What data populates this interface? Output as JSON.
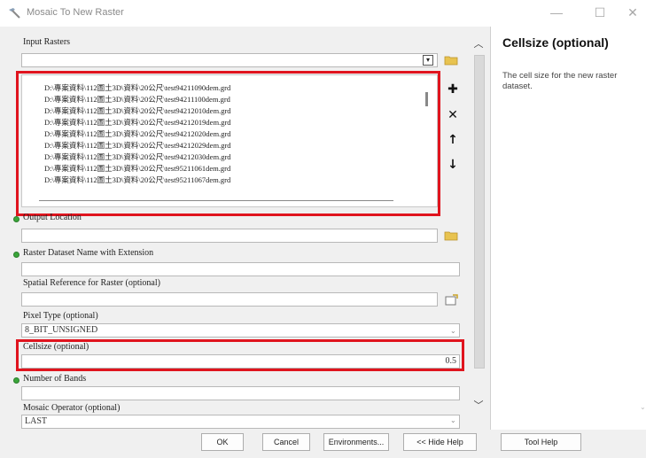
{
  "window": {
    "title": "Mosaic To New Raster",
    "minimize_glyph": "—",
    "maximize_glyph": "☐",
    "close_glyph": "✕"
  },
  "form": {
    "input_rasters": {
      "label": "Input Rasters",
      "items": [
        "D:\\專案資料\\112圖土3D\\資料\\20公尺\\test94211090dem.grd",
        "D:\\專案資料\\112圖土3D\\資料\\20公尺\\test94211100dem.grd",
        "D:\\專案資料\\112圖土3D\\資料\\20公尺\\test94212010dem.grd",
        "D:\\專案資料\\112圖土3D\\資料\\20公尺\\test94212019dem.grd",
        "D:\\專案資料\\112圖土3D\\資料\\20公尺\\test94212020dem.grd",
        "D:\\專案資料\\112圖土3D\\資料\\20公尺\\test94212029dem.grd",
        "D:\\專案資料\\112圖土3D\\資料\\20公尺\\test94212030dem.grd",
        "D:\\專案資料\\112圖土3D\\資料\\20公尺\\test95211061dem.grd",
        "D:\\專案資料\\112圖土3D\\資料\\20公尺\\test95211067dem.grd"
      ]
    },
    "output_location": {
      "label": "Output Location",
      "value": ""
    },
    "raster_dataset_name": {
      "label": "Raster Dataset Name with Extension",
      "value": ""
    },
    "spatial_reference": {
      "label": "Spatial Reference for Raster (optional)",
      "value": ""
    },
    "pixel_type": {
      "label": "Pixel Type (optional)",
      "value": "8_BIT_UNSIGNED"
    },
    "cellsize": {
      "label": "Cellsize (optional)",
      "value": "0.5"
    },
    "number_of_bands": {
      "label": "Number of Bands",
      "value": ""
    },
    "mosaic_operator": {
      "label": "Mosaic Operator (optional)",
      "value": "LAST"
    }
  },
  "help": {
    "title": "Cellsize (optional)",
    "body": "The cell size for the new raster dataset."
  },
  "buttons": {
    "ok": "OK",
    "cancel": "Cancel",
    "environments": "Environments...",
    "hide_help": "<< Hide Help",
    "tool_help": "Tool Help"
  },
  "icons": {
    "add": "plus-icon",
    "remove": "x-icon",
    "up": "arrow-up-icon",
    "down": "arrow-down-icon",
    "browse": "folder-icon"
  },
  "colors": {
    "highlight_red": "#e0141e",
    "required_green": "#3aa63a"
  }
}
